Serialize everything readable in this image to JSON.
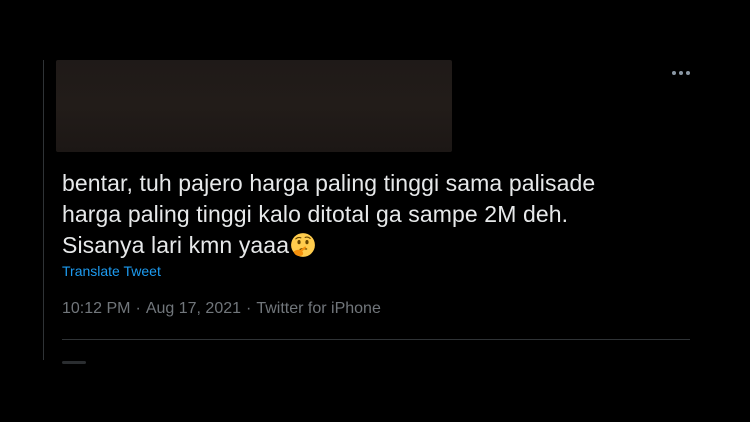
{
  "tweet": {
    "text_lines": [
      "bentar, tuh pajero harga paling tinggi sama palisade",
      "harga paling tinggi kalo ditotal ga sampe 2M deh.",
      "Sisanya lari kmn yaaa"
    ],
    "emoji": "thinking-face-icon",
    "translate_label": "Translate Tweet",
    "time": "10:12 PM",
    "date": "Aug 17, 2021",
    "source": "Twitter for iPhone",
    "separator": "·"
  },
  "icons": {
    "more": "more-horizontal-icon"
  },
  "colors": {
    "background": "#000000",
    "text": "#e7e9ea",
    "link": "#1d9bf0",
    "muted": "#71767b",
    "border": "#2f3336"
  }
}
